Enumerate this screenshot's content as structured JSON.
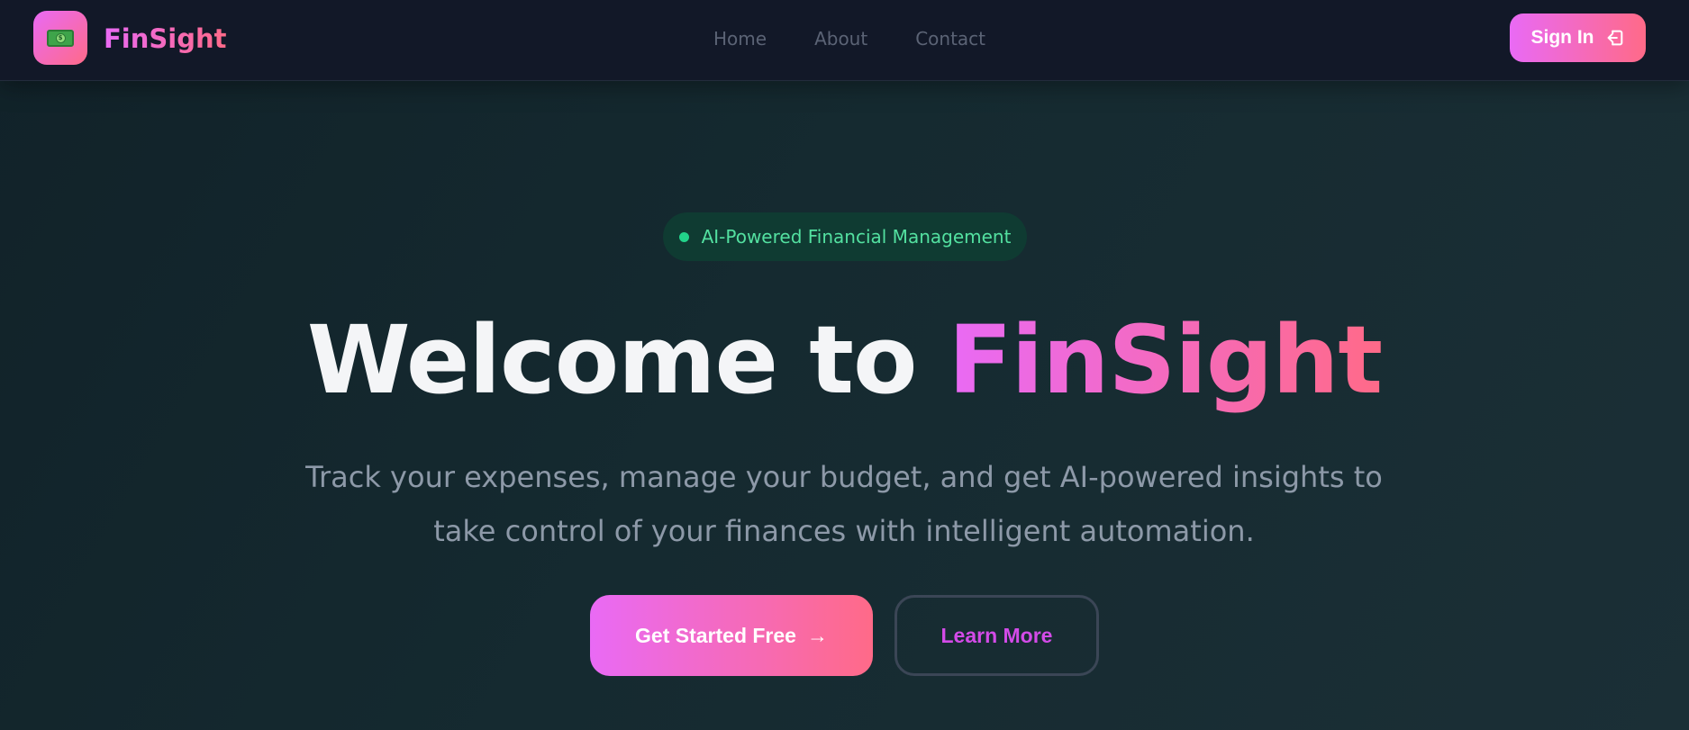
{
  "nav": {
    "brand": "FinSight",
    "logo_icon": "money-bill-icon",
    "links": [
      {
        "label": "Home"
      },
      {
        "label": "About"
      },
      {
        "label": "Contact"
      }
    ],
    "signin_label": "Sign In",
    "signin_icon": "sign-in-icon"
  },
  "hero": {
    "badge_text": "AI-Powered Financial Management",
    "title_prefix": "Welcome to ",
    "title_accent": "FinSight",
    "subtitle": "Track your expenses, manage your budget, and get AI-powered insights to take control of your finances with intelligent automation.",
    "primary_cta": "Get Started Free",
    "primary_cta_arrow": "→",
    "secondary_cta": "Learn More"
  },
  "colors": {
    "accent_start": "#e96af5",
    "accent_end": "#ff6a88",
    "badge_green": "#22d38a",
    "nav_bg": "#121828",
    "hero_bg": "#152a30"
  }
}
